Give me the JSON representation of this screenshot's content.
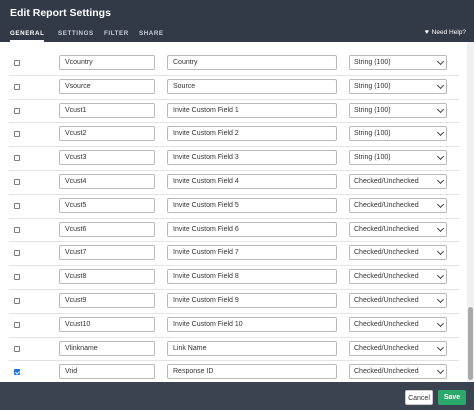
{
  "header": {
    "title": "Edit Report Settings",
    "tabs": [
      {
        "label": "GENERAL"
      },
      {
        "label": "SETTINGS"
      },
      {
        "label": "FILTER"
      },
      {
        "label": "SHARE"
      }
    ],
    "help_label": "Need Help?"
  },
  "rows": [
    {
      "checked": false,
      "name": "Vcountry",
      "label": "Country",
      "type": "String (100)"
    },
    {
      "checked": false,
      "name": "Vsource",
      "label": "Source",
      "type": "String (100)"
    },
    {
      "checked": false,
      "name": "Vcust1",
      "label": "Invite Custom Field 1",
      "type": "String (100)"
    },
    {
      "checked": false,
      "name": "Vcust2",
      "label": "Invite Custom Field 2",
      "type": "String (100)"
    },
    {
      "checked": false,
      "name": "Vcust3",
      "label": "Invite Custom Field 3",
      "type": "String (100)"
    },
    {
      "checked": false,
      "name": "Vcust4",
      "label": "Invite Custom Field 4",
      "type": "Checked/Unchecked"
    },
    {
      "checked": false,
      "name": "Vcust5",
      "label": "Invite Custom Field 5",
      "type": "Checked/Unchecked"
    },
    {
      "checked": false,
      "name": "Vcust6",
      "label": "Invite Custom Field 6",
      "type": "Checked/Unchecked"
    },
    {
      "checked": false,
      "name": "Vcust7",
      "label": "Invite Custom Field 7",
      "type": "Checked/Unchecked"
    },
    {
      "checked": false,
      "name": "Vcust8",
      "label": "Invite Custom Field 8",
      "type": "Checked/Unchecked"
    },
    {
      "checked": false,
      "name": "Vcust9",
      "label": "Invite Custom Field 9",
      "type": "Checked/Unchecked"
    },
    {
      "checked": false,
      "name": "Vcust10",
      "label": "Invite Custom Field 10",
      "type": "Checked/Unchecked"
    },
    {
      "checked": false,
      "name": "Vlinkname",
      "label": "Link Name",
      "type": "Checked/Unchecked"
    },
    {
      "checked": true,
      "name": "Vrid",
      "label": "Response ID",
      "type": "Checked/Unchecked"
    }
  ],
  "footer": {
    "cancel_label": "Cancel",
    "save_label": "Save"
  },
  "colors": {
    "header_bg": "#323a48",
    "save_green": "#2aa96b",
    "checkbox_blue": "#1a73e8"
  }
}
